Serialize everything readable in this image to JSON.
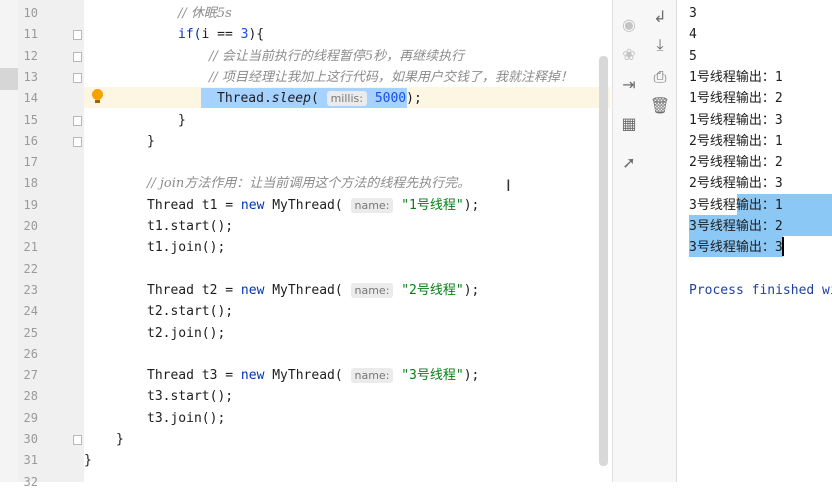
{
  "editor": {
    "lines": [
      {
        "n": "10",
        "tokens": [
          {
            "t": "// 休眠5s",
            "c": "cm"
          }
        ]
      },
      {
        "n": "11",
        "tokens": [
          {
            "t": "if(",
            "c": "kw"
          },
          {
            "t": "i",
            "c": ""
          },
          {
            "t": " == ",
            "c": ""
          },
          {
            "t": "3",
            "c": "num"
          },
          {
            "t": "){",
            "c": ""
          }
        ]
      },
      {
        "n": "12",
        "tokens": [
          {
            "t": "// 会让当前执行的线程暂停5秒，再继续执行",
            "c": "cm"
          }
        ]
      },
      {
        "n": "13",
        "tokens": [
          {
            "t": "// 项目经理让我加上这行代码，如果用户交钱了，我就注释掉！",
            "c": "cm"
          }
        ]
      },
      {
        "n": "14",
        "tokens": [
          {
            "t": "Thread.",
            "c": ""
          },
          {
            "t": "sleep",
            "c": "it"
          },
          {
            "t": "( ",
            "c": ""
          },
          {
            "t": "millis:",
            "c": "hint"
          },
          {
            "t": " ",
            "c": ""
          },
          {
            "t": "5000",
            "c": "num"
          },
          {
            "t": ");",
            "c": ""
          }
        ]
      },
      {
        "n": "15",
        "tokens": [
          {
            "t": "}",
            "c": ""
          }
        ]
      },
      {
        "n": "16",
        "tokens": [
          {
            "t": "}",
            "c": ""
          }
        ]
      },
      {
        "n": "17",
        "tokens": []
      },
      {
        "n": "18",
        "tokens": [
          {
            "t": "// join方法作用：让当前调用这个方法的线程先执行完。",
            "c": "cm"
          }
        ]
      },
      {
        "n": "19",
        "tokens": [
          {
            "t": "Thread t1 = ",
            "c": ""
          },
          {
            "t": "new",
            "c": "kw"
          },
          {
            "t": " MyThread( ",
            "c": ""
          },
          {
            "t": "name:",
            "c": "hint"
          },
          {
            "t": " ",
            "c": ""
          },
          {
            "t": "\"1号线程\"",
            "c": "str"
          },
          {
            "t": ");",
            "c": ""
          }
        ]
      },
      {
        "n": "20",
        "tokens": [
          {
            "t": "t1.start();",
            "c": ""
          }
        ]
      },
      {
        "n": "21",
        "tokens": [
          {
            "t": "t1.join();",
            "c": ""
          }
        ]
      },
      {
        "n": "22",
        "tokens": []
      },
      {
        "n": "23",
        "tokens": [
          {
            "t": "Thread t2 = ",
            "c": ""
          },
          {
            "t": "new",
            "c": "kw"
          },
          {
            "t": " MyThread( ",
            "c": ""
          },
          {
            "t": "name:",
            "c": "hint"
          },
          {
            "t": " ",
            "c": ""
          },
          {
            "t": "\"2号线程\"",
            "c": "str"
          },
          {
            "t": ");",
            "c": ""
          }
        ]
      },
      {
        "n": "24",
        "tokens": [
          {
            "t": "t2.start();",
            "c": ""
          }
        ]
      },
      {
        "n": "25",
        "tokens": [
          {
            "t": "t2.join();",
            "c": ""
          }
        ]
      },
      {
        "n": "26",
        "tokens": []
      },
      {
        "n": "27",
        "tokens": [
          {
            "t": "Thread t3 = ",
            "c": ""
          },
          {
            "t": "new",
            "c": "kw"
          },
          {
            "t": " MyThread( ",
            "c": ""
          },
          {
            "t": "name:",
            "c": "hint"
          },
          {
            "t": " ",
            "c": ""
          },
          {
            "t": "\"3号线程\"",
            "c": "str"
          },
          {
            "t": ");",
            "c": ""
          }
        ]
      },
      {
        "n": "28",
        "tokens": [
          {
            "t": "t3.start();",
            "c": ""
          }
        ]
      },
      {
        "n": "29",
        "tokens": [
          {
            "t": "t3.join();",
            "c": ""
          }
        ]
      },
      {
        "n": "30",
        "tokens": [
          {
            "t": "}",
            "c": ""
          }
        ]
      },
      {
        "n": "31",
        "tokens": [
          {
            "t": "}",
            "c": ""
          }
        ]
      },
      {
        "n": "32",
        "tokens": []
      }
    ]
  },
  "console": {
    "lines": [
      "3",
      "4",
      "5",
      "1号线程输出：1",
      "1号线程输出：2",
      "1号线程输出：3",
      "2号线程输出：1",
      "2号线程输出：2",
      "2号线程输出：3",
      "3号线程输出：1",
      "3号线程输出：2",
      "3号线程输出：3",
      "",
      "Process finished wi"
    ]
  },
  "tools_left": [
    "camera-icon",
    "bug-icon",
    "exit-icon",
    "layout-icon",
    "pin-icon"
  ],
  "tools_right": [
    "soft-wrap-icon",
    "scroll-to-end-icon",
    "print-icon",
    "trash-icon"
  ],
  "colors": {
    "keyword": "#0033b3",
    "number": "#1750eb",
    "string": "#067d17",
    "comment": "#8c8c8c",
    "selection": "#a6d2ff"
  }
}
